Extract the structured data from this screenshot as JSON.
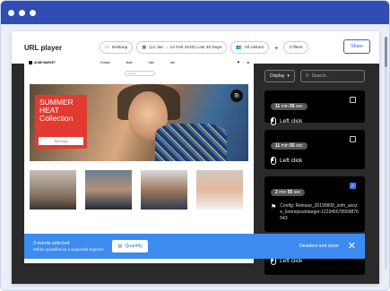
{
  "header": {
    "title": "URL player",
    "device_filter": "Desktop",
    "date_filter": "(12 Jan → 12 Feb 2020) Last 30 Days",
    "visitors_filter": "All visitors",
    "add_label": "+",
    "filters_count": "3 filters",
    "share_label": "Share"
  },
  "site": {
    "brand": "ACME MARKET",
    "nav_links": [
      "Female",
      "Male",
      "Kids",
      "Info"
    ],
    "search_placeholder": "Search",
    "hero_text": "SUMMER HEAT Collection",
    "hero_button": "See Now"
  },
  "toolbar": {
    "display_label": "Display",
    "search_placeholder": "Search..."
  },
  "events": [
    {
      "time_min": "11",
      "time_sec": "55",
      "label": "Left click",
      "checked": false
    },
    {
      "time_min": "11",
      "time_sec": "55",
      "label": "Left click",
      "checked": false
    },
    {
      "time_min": "2",
      "time_sec": "55",
      "label": "Config: Release_20190808_zofri_asoze_loremipsumtarget-122345678909876543",
      "checked": true
    },
    {
      "time_min": "",
      "time_sec": "",
      "label": "Left click",
      "checked": false
    }
  ],
  "selection": {
    "title": "3 events selected",
    "subtitle": "Will be quantified as a sequential segment",
    "quantify_label": "Quantify",
    "deselect_label": "Deselect and close"
  },
  "colors": {
    "mac_bar": "#2f4db3",
    "accent": "#3d8bef",
    "player_bg": "#2a2a2a",
    "promo": "#e23a30"
  }
}
